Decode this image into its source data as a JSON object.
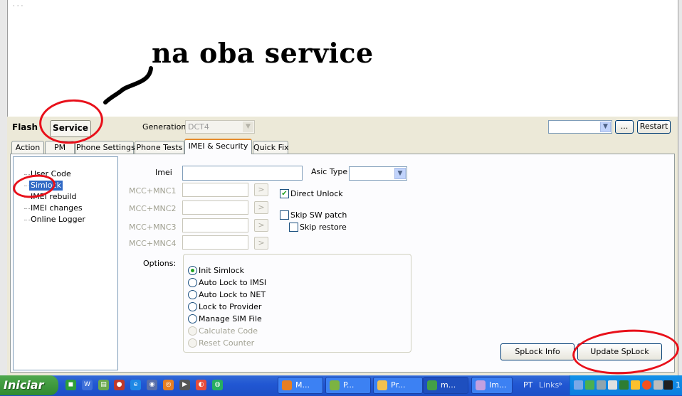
{
  "annotation": {
    "text": "na oba service"
  },
  "top_text": "· · ·",
  "header": {
    "flash_label": "Flash",
    "service_label": "Service",
    "generation_label": "Generation:",
    "generation_value": "DCT4",
    "browse_label": "...",
    "restart_label": "Restart"
  },
  "tabs": [
    {
      "label": "Action"
    },
    {
      "label": "PM"
    },
    {
      "label": "Phone Settings"
    },
    {
      "label": "Phone Tests"
    },
    {
      "label": "IMEI & Security",
      "active": true
    },
    {
      "label": "Quick Fix"
    }
  ],
  "tree": {
    "items": [
      "User Code",
      "Simlock",
      "IMEI rebuild",
      "IMEI changes",
      "Online Logger"
    ],
    "selected": "Simlock"
  },
  "form": {
    "imei_label": "Imei",
    "asic_label": "Asic Type",
    "mcc_labels": [
      "MCC+MNC1",
      "MCC+MNC2",
      "MCC+MNC3",
      "MCC+MNC4"
    ],
    "arrow_label": ">",
    "direct_unlock_label": "Direct Unlock",
    "direct_unlock_checked": true,
    "skip_sw_patch_label": "Skip SW patch",
    "skip_restore_label": "Skip restore",
    "options_label": "Options:",
    "options": [
      {
        "label": "Init Simlock",
        "selected": true,
        "enabled": true
      },
      {
        "label": "Auto Lock to IMSI",
        "selected": false,
        "enabled": true
      },
      {
        "label": "Auto Lock to NET",
        "selected": false,
        "enabled": true
      },
      {
        "label": "Lock to Provider",
        "selected": false,
        "enabled": true
      },
      {
        "label": "Manage SIM File",
        "selected": false,
        "enabled": true
      },
      {
        "label": "Calculate Code",
        "selected": false,
        "enabled": false
      },
      {
        "label": "Reset Counter",
        "selected": false,
        "enabled": false
      }
    ],
    "splock_info_label": "SpLock Info",
    "update_splock_label": "Update SpLock"
  },
  "taskbar": {
    "start_label": "Iniciar",
    "tasks": [
      "M...",
      "P...",
      "Pr...",
      "m...",
      "Im..."
    ],
    "language": "PT",
    "links_label": "Links",
    "clock": "1"
  },
  "colors": {
    "annotation_red": "#e8101a",
    "selection_blue": "#316ac5",
    "taskbar_blue": "#2157d3",
    "start_green": "#3a9a38",
    "active_tab_orange": "#e68b2c"
  }
}
